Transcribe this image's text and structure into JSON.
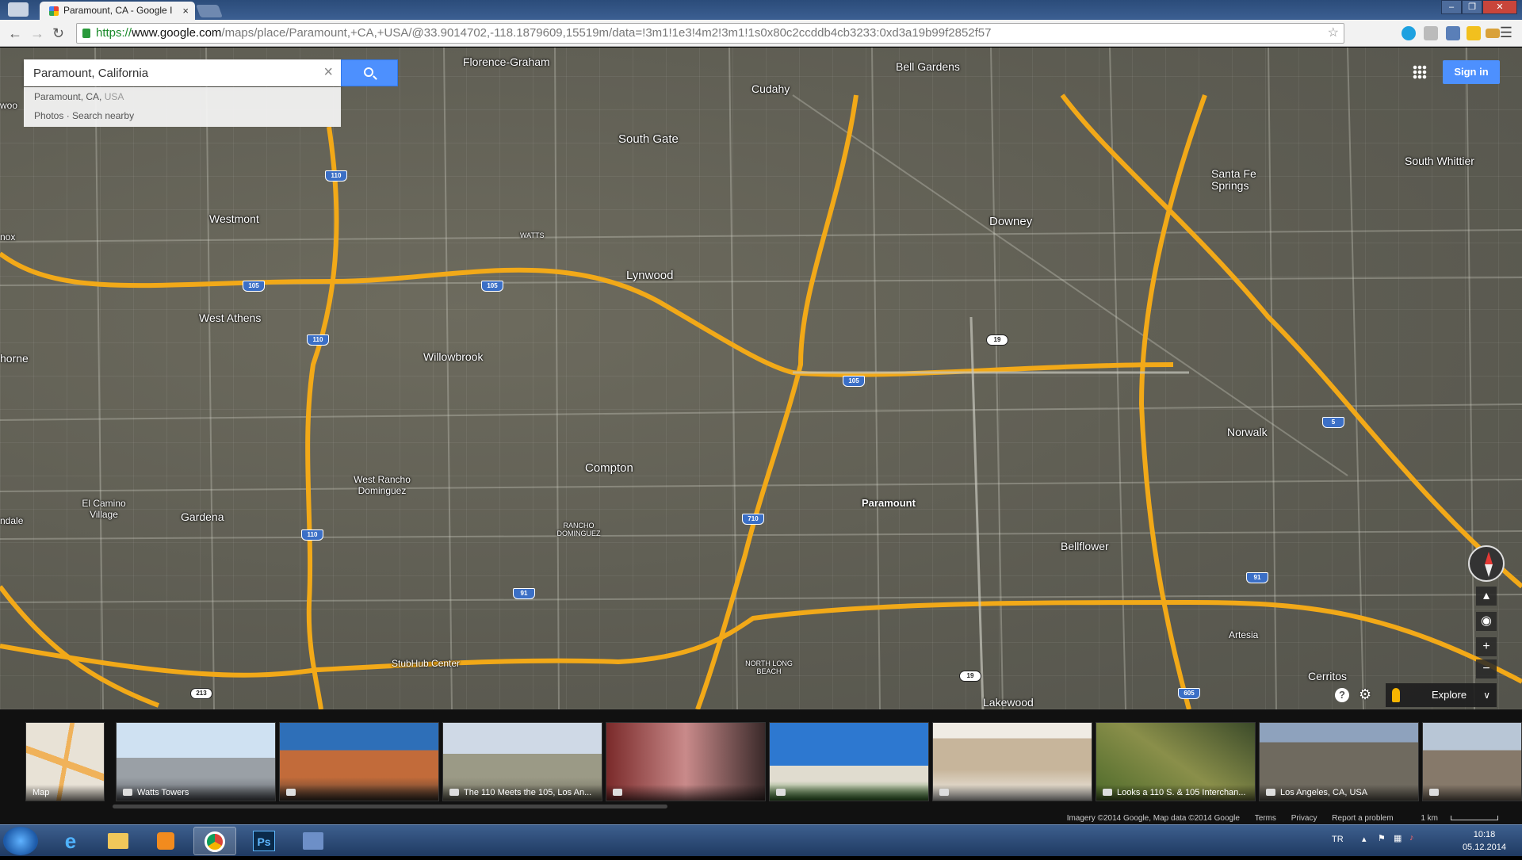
{
  "browser": {
    "tab_title": "Paramount, CA - Google I",
    "tab_close": "×",
    "url_scheme": "https://",
    "url_host": "www.google.com",
    "url_path": "/maps/place/Paramount,+CA,+USA/@33.9014702,-118.1879609,15519m/data=!3m1!1e3!4m2!3m1!1s0x80c2ccddb4cb3233:0xd3a19b99f2852f57",
    "window_buttons": [
      "–",
      "❐",
      "✕"
    ]
  },
  "maps": {
    "search_value": "Paramount, California",
    "suggestions": [
      {
        "main": "Paramount, CA,",
        "secondary": "USA"
      },
      {
        "main": "Photos · Search nearby",
        "secondary": ""
      }
    ],
    "sign_in_label": "Sign in",
    "explore_label": "Explore",
    "help_label": "?",
    "zoom_in": "+",
    "zoom_out": "−"
  },
  "places": [
    {
      "name": "Florence-Graham"
    },
    {
      "name": "Cudahy"
    },
    {
      "name": "Bell Gardens"
    },
    {
      "name": "South Gate"
    },
    {
      "name": "Westmont"
    },
    {
      "name": "WATTS"
    },
    {
      "name": "Downey"
    },
    {
      "name": "Santa Fe Springs"
    },
    {
      "name": "South Whittier"
    },
    {
      "name": "Lynwood"
    },
    {
      "name": "West Athens"
    },
    {
      "name": "Willowbrook"
    },
    {
      "name": "Compton"
    },
    {
      "name": "West Rancho Dominguez"
    },
    {
      "name": "El Camino Village"
    },
    {
      "name": "Gardena"
    },
    {
      "name": "RANCHO DOMINGUEZ"
    },
    {
      "name": "Paramount"
    },
    {
      "name": "Bellflower"
    },
    {
      "name": "Norwalk"
    },
    {
      "name": "Artesia"
    },
    {
      "name": "Cerritos"
    },
    {
      "name": "StubHub Center"
    },
    {
      "name": "NORTH LONG BEACH"
    },
    {
      "name": "Lakewood"
    },
    {
      "name": "nox"
    },
    {
      "name": "horne"
    },
    {
      "name": "ndale"
    },
    {
      "name": "woo"
    }
  ],
  "shields": [
    "110",
    "105",
    "105",
    "110",
    "110",
    "105",
    "19",
    "5",
    "710",
    "91",
    "91",
    "605",
    "19",
    "213"
  ],
  "filmstrip": [
    {
      "caption": "Map"
    },
    {
      "caption": "Watts Towers"
    },
    {
      "caption": ""
    },
    {
      "caption": "The 110 Meets the 105, Los An..."
    },
    {
      "caption": ""
    },
    {
      "caption": ""
    },
    {
      "caption": ""
    },
    {
      "caption": "Looks a 110 S. & 105 Interchan..."
    },
    {
      "caption": "Los Angeles, CA, USA"
    },
    {
      "caption": ""
    }
  ],
  "credits": {
    "imagery": "Imagery ©2014 Google, Map data ©2014 Google",
    "terms": "Terms",
    "privacy": "Privacy",
    "report": "Report a problem",
    "scale": "1 km"
  },
  "taskbar": {
    "lang": "TR",
    "time": "10:18",
    "date": "05.12.2014",
    "ps_label": "Ps"
  },
  "colors": {
    "freeway": "#f2a918",
    "accent": "#4d90fe",
    "map_ground": "#5e5d53"
  }
}
